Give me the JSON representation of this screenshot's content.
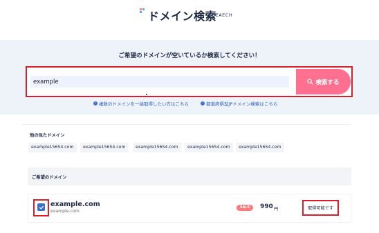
{
  "header": {
    "title": "ドメイン検索",
    "subtitle": "SEAECH"
  },
  "search": {
    "prompt": "ご希望のドメインが空いているか検索してください！",
    "input_value": "example",
    "button_label": "検索する",
    "links": [
      {
        "label": "複数のドメインを一括取得したい方はこちら"
      },
      {
        "label": "都道府県型JPドメイン検索はこちら"
      }
    ]
  },
  "similar": {
    "title": "他の似たドメイン",
    "domains": [
      "example15654.com",
      "example15654.com",
      "example15654.com",
      "example15654.com",
      "example15654.com"
    ]
  },
  "desired": {
    "title": "ご希望のドメイン",
    "result": {
      "checked": true,
      "domain": "example.com",
      "domain_sub": "example.com",
      "badge": "SALE",
      "price": "990",
      "unit": "円",
      "status": "取得可能です"
    }
  },
  "colors": {
    "accent_button": "#ff6f8f",
    "highlight_border": "#d81e2a",
    "link": "#2f5fb8",
    "panel_bg": "#eef2f9",
    "checkbox": "#3a6fd0",
    "sale_badge": "#ff7a7a"
  }
}
